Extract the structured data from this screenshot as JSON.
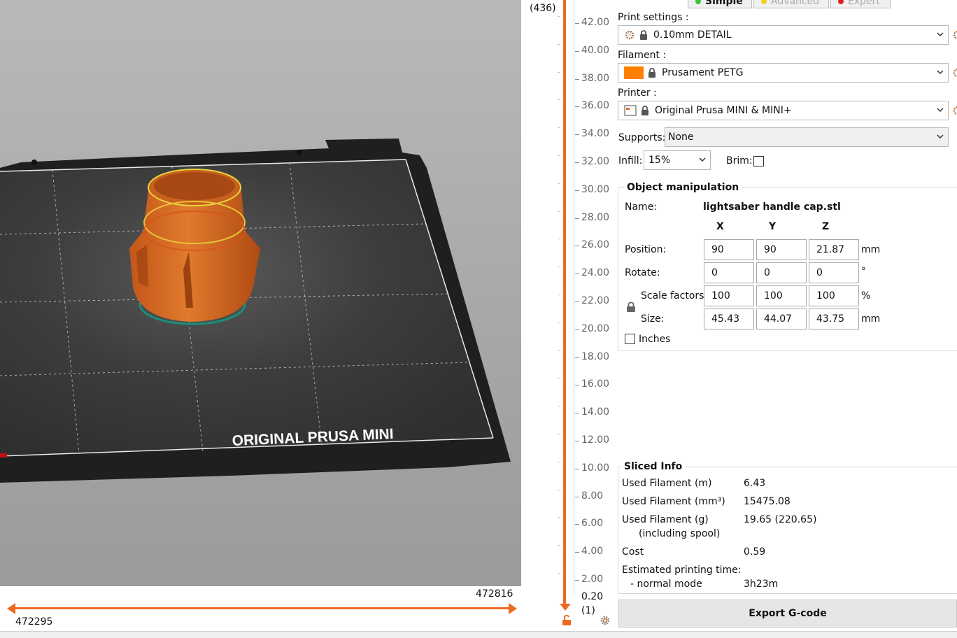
{
  "viewport": {
    "bed_label": "ORIGINAL PRUSA MINI"
  },
  "horizontal_slider": {
    "upper_value": "472816",
    "lower_value": "472295",
    "accent_color": "#ed6b21"
  },
  "vertical_slider": {
    "top_value": "(436)",
    "ticks": [
      "42.00",
      "40.00",
      "38.00",
      "36.00",
      "34.00",
      "32.00",
      "30.00",
      "28.00",
      "26.00",
      "24.00",
      "22.00",
      "20.00",
      "18.00",
      "16.00",
      "14.00",
      "12.00",
      "10.00",
      "8.00",
      "6.00",
      "4.00",
      "2.00"
    ],
    "bottom_value": "0.20",
    "bottom_layer": "(1)"
  },
  "mode_tabs": [
    "Simple",
    "Advanced",
    "Expert"
  ],
  "print_settings": {
    "label": "Print settings :",
    "value": "0.10mm DETAIL"
  },
  "filament": {
    "label": "Filament :",
    "value": "Prusament PETG",
    "color": "#ff8000"
  },
  "printer": {
    "label": "Printer :",
    "value": "Original Prusa MINI & MINI+"
  },
  "supports": {
    "label": "Supports:",
    "value": "None"
  },
  "infill": {
    "label": "Infill:",
    "value": "15%"
  },
  "brim": {
    "label": "Brim:",
    "checked": false
  },
  "object_manipulation": {
    "title": "Object manipulation",
    "name_label": "Name:",
    "name_value": "lightsaber handle cap.stl",
    "axis_x": "X",
    "axis_y": "Y",
    "axis_z": "Z",
    "position": {
      "label": "Position:",
      "x": "90",
      "y": "90",
      "z": "21.87",
      "unit": "mm"
    },
    "rotate": {
      "label": "Rotate:",
      "x": "0",
      "y": "0",
      "z": "0",
      "unit": "°"
    },
    "scale": {
      "label": "Scale factors:",
      "x": "100",
      "y": "100",
      "z": "100",
      "unit": "%"
    },
    "size": {
      "label": "Size:",
      "x": "45.43",
      "y": "44.07",
      "z": "43.75",
      "unit": "mm"
    },
    "inches_label": "Inches"
  },
  "sliced_info": {
    "title": "Sliced Info",
    "used_filament_m_label": "Used Filament (m)",
    "used_filament_m": "6.43",
    "used_filament_mm3_label": "Used Filament (mm³)",
    "used_filament_mm3": "15475.08",
    "used_filament_g_label": "Used Filament (g)",
    "used_filament_g": "19.65 (220.65)",
    "including_spool": "(including spool)",
    "cost_label": "Cost",
    "cost": "0.59",
    "est_time_label": "Estimated printing time:",
    "normal_mode_label": "- normal mode",
    "normal_mode": "3h23m"
  },
  "export_button": "Export G-code"
}
